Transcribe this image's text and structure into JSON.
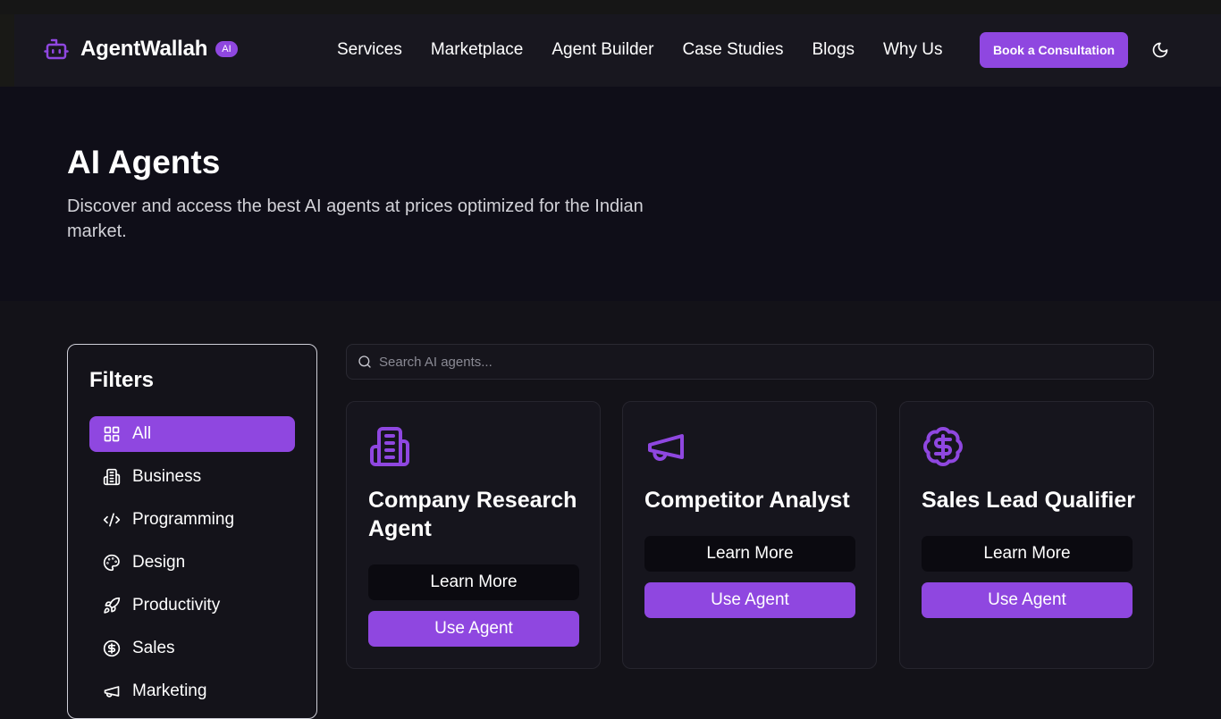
{
  "brand": {
    "name": "AgentWallah",
    "badge": "AI",
    "accent": "#8f47e0"
  },
  "nav": {
    "links": [
      "Services",
      "Marketplace",
      "Agent Builder",
      "Case Studies",
      "Blogs",
      "Why Us"
    ],
    "cta": "Book a Consultation",
    "theme_icon": "moon-icon"
  },
  "hero": {
    "title": "AI Agents",
    "subtitle": "Discover and access the best AI agents at prices optimized for the Indian market."
  },
  "filters": {
    "title": "Filters",
    "items": [
      {
        "label": "All",
        "icon": "grid-icon",
        "active": true
      },
      {
        "label": "Business",
        "icon": "building-icon"
      },
      {
        "label": "Programming",
        "icon": "code-icon"
      },
      {
        "label": "Design",
        "icon": "palette-icon"
      },
      {
        "label": "Productivity",
        "icon": "rocket-icon"
      },
      {
        "label": "Sales",
        "icon": "dollar-circle-icon"
      },
      {
        "label": "Marketing",
        "icon": "megaphone-icon"
      }
    ]
  },
  "search": {
    "placeholder": "Search AI agents..."
  },
  "cards": [
    {
      "title": "Company Research Agent",
      "icon": "building-icon",
      "learn_more": "Learn More",
      "use_agent": "Use Agent"
    },
    {
      "title": "Competitor Analyst",
      "icon": "megaphone-icon",
      "learn_more": "Learn More",
      "use_agent": "Use Agent"
    },
    {
      "title": "Sales Lead Qualifier",
      "icon": "dollar-badge-icon",
      "learn_more": "Learn More",
      "use_agent": "Use Agent"
    }
  ]
}
